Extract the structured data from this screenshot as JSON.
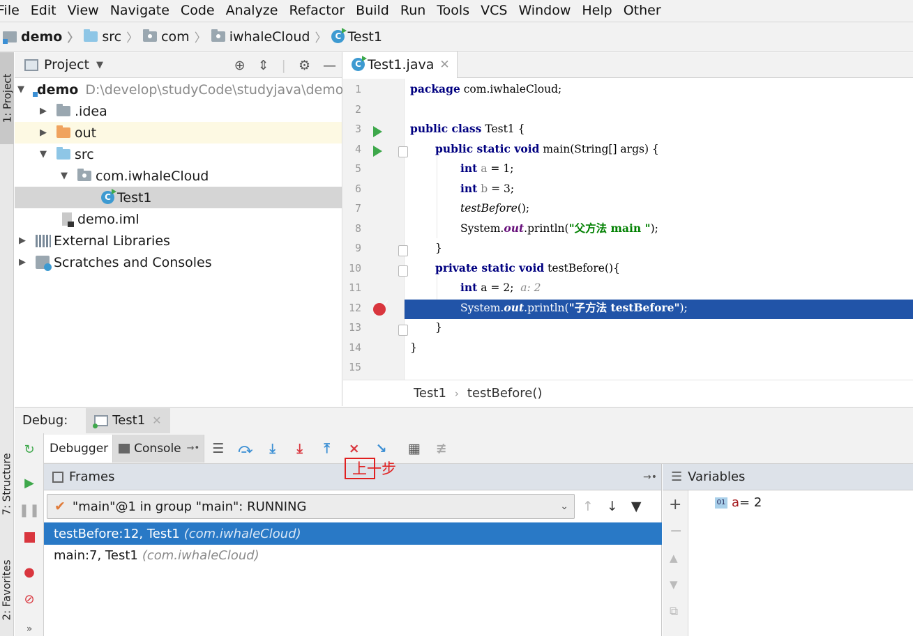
{
  "menu": [
    "File",
    "Edit",
    "View",
    "Navigate",
    "Code",
    "Analyze",
    "Refactor",
    "Build",
    "Run",
    "Tools",
    "VCS",
    "Window",
    "Help",
    "Other"
  ],
  "breadcrumbs": [
    "demo",
    "src",
    "com",
    "iwhaleCloud",
    "Test1"
  ],
  "stripe": {
    "project": "1: Project",
    "structure": "7: Structure",
    "favorites": "2: Favorites"
  },
  "project_panel": {
    "title": "Project",
    "tree": [
      {
        "label": "demo",
        "path": "D:\\develop\\studyCode\\studyjava\\demo"
      },
      {
        "label": ".idea"
      },
      {
        "label": "out"
      },
      {
        "label": "src"
      },
      {
        "label": "com.iwhaleCloud"
      },
      {
        "label": "Test1"
      },
      {
        "label": "demo.iml"
      },
      {
        "label": "External Libraries"
      },
      {
        "label": "Scratches and Consoles"
      }
    ]
  },
  "editor": {
    "tab": "Test1.java",
    "line_numbers": [
      "1",
      "2",
      "3",
      "4",
      "5",
      "6",
      "7",
      "8",
      "9",
      "10",
      "11",
      "12",
      "13",
      "14",
      "15"
    ],
    "code": {
      "l1_kw": "package",
      "l1_rest": " com.iwhaleCloud;",
      "l3_kw": "public class",
      "l3_rest": " Test1 {",
      "l4_kw": "public static void",
      "l4_rest": " main(String[] args) {",
      "l5_kw": "int",
      "l5_var": " a",
      "l5_rest": " = 1;",
      "l6_kw": "int",
      "l6_var": " b",
      "l6_rest": " = 3;",
      "l7_call": "testBefore",
      "l7_rest": "();",
      "l8_a": "System.",
      "l8_out": "out",
      "l8_b": ".println(",
      "l8_str": "\"父方法 main \"",
      "l8_c": ");",
      "l9": "}",
      "l10_kw": "private static void",
      "l10_rest": " testBefore(){",
      "l11_kw": "int",
      "l11_rest": " a = 2;",
      "l11_hint": "a: 2",
      "l12_a": "System.",
      "l12_out": "out",
      "l12_b": ".println(",
      "l12_str": "\"子方法 testBefore\"",
      "l12_c": ");",
      "l13": "}",
      "l14": "}"
    },
    "crumbs": [
      "Test1",
      "testBefore()"
    ]
  },
  "debug": {
    "label": "Debug:",
    "tab": "Test1",
    "subtabs": [
      "Debugger",
      "Console"
    ],
    "frames_title": "Frames",
    "thread": "\"main\"@1 in group \"main\": RUNNING",
    "frames": [
      {
        "method": "testBefore:12, Test1",
        "pkg": "(com.iwhaleCloud)"
      },
      {
        "method": "main:7, Test1",
        "pkg": "(com.iwhaleCloud)"
      }
    ],
    "variables_title": "Variables",
    "variable": {
      "icon": "01",
      "name": "a",
      "value": " = 2"
    }
  },
  "annotation": {
    "text": "上一步",
    "color": "#e02020"
  },
  "colors": {
    "selection": "#2154a8",
    "frame_selection": "#2979c6",
    "keyword": "#000080",
    "string": "#008000"
  }
}
